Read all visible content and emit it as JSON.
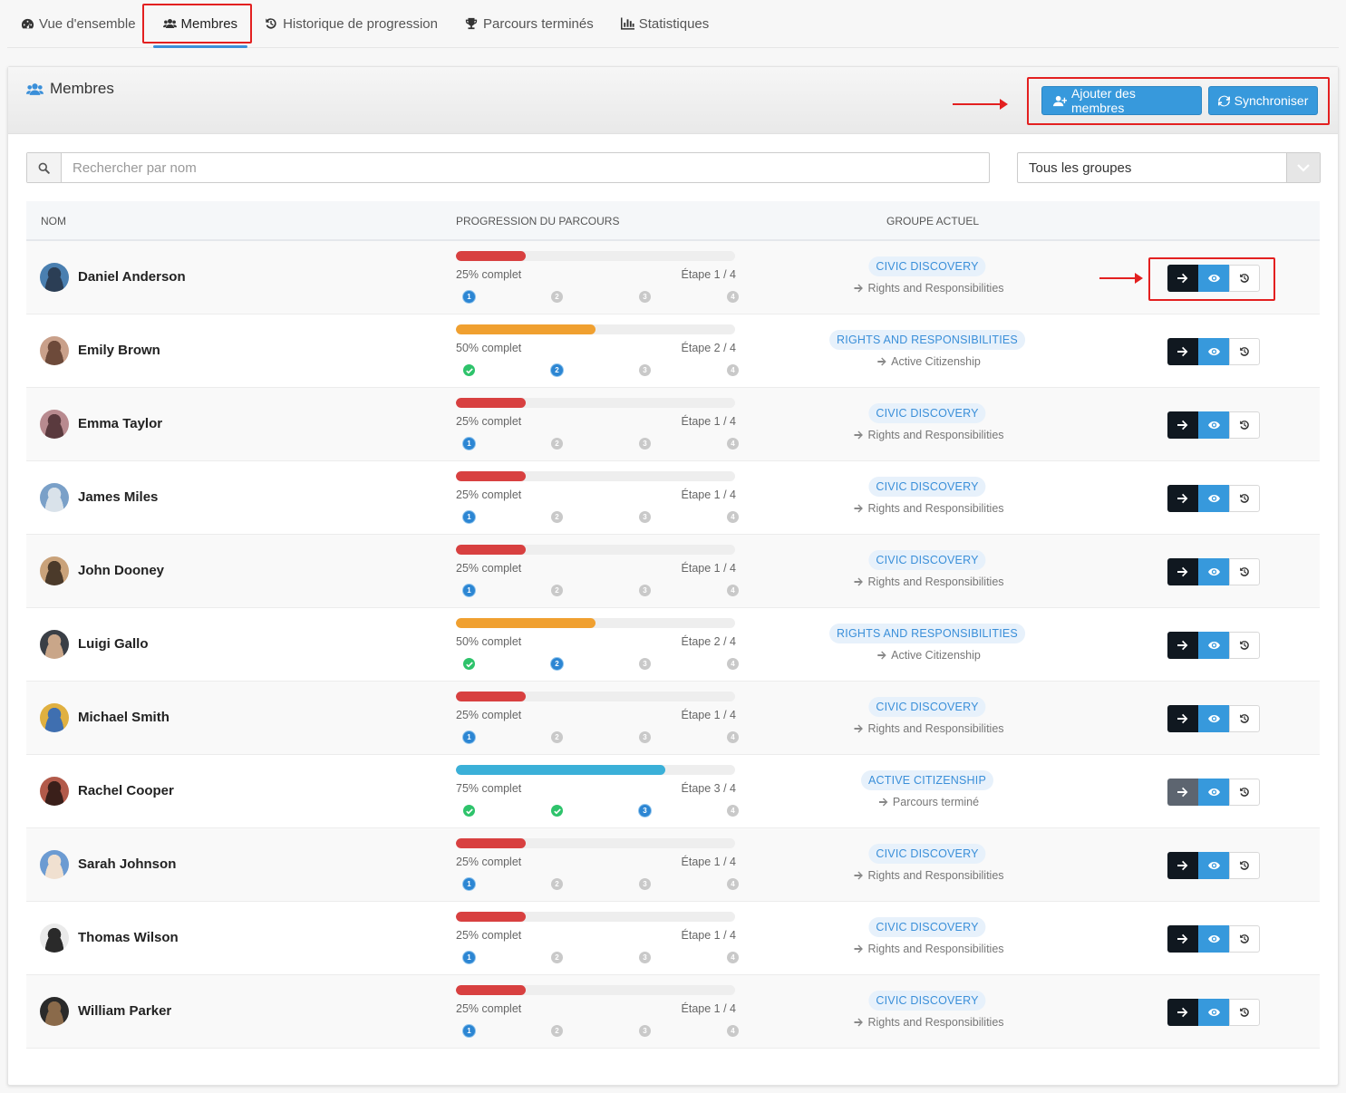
{
  "tabs": [
    {
      "label": "Vue d'ensemble",
      "icon": "dashboard-icon"
    },
    {
      "label": "Membres",
      "icon": "users-icon",
      "active": true
    },
    {
      "label": "Historique de progression",
      "icon": "history-icon"
    },
    {
      "label": "Parcours terminés",
      "icon": "trophy-icon"
    },
    {
      "label": "Statistiques",
      "icon": "bar-chart-icon"
    }
  ],
  "panel": {
    "title": "Membres",
    "add_button": "Ajouter des membres",
    "sync_button": "Synchroniser"
  },
  "search": {
    "placeholder": "Rechercher par nom"
  },
  "group_filter": {
    "selected": "Tous les groupes"
  },
  "table": {
    "headers": {
      "name": "NOM",
      "progress": "PROGRESSION DU PARCOURS",
      "group": "GROUPE ACTUEL"
    },
    "rows": [
      {
        "name": "Daniel Anderson",
        "progress": 25,
        "pct": "25% complet",
        "step": "Étape 1 / 4",
        "current_step": 1,
        "group": "CIVIC DISCOVERY",
        "next": "Rights and Responsibilities"
      },
      {
        "name": "Emily Brown",
        "progress": 50,
        "pct": "50% complet",
        "step": "Étape 2 / 4",
        "current_step": 2,
        "group": "RIGHTS AND RESPONSIBILITIES",
        "next": "Active Citizenship"
      },
      {
        "name": "Emma Taylor",
        "progress": 25,
        "pct": "25% complet",
        "step": "Étape 1 / 4",
        "current_step": 1,
        "group": "CIVIC DISCOVERY",
        "next": "Rights and Responsibilities"
      },
      {
        "name": "James Miles",
        "progress": 25,
        "pct": "25% complet",
        "step": "Étape 1 / 4",
        "current_step": 1,
        "group": "CIVIC DISCOVERY",
        "next": "Rights and Responsibilities"
      },
      {
        "name": "John Dooney",
        "progress": 25,
        "pct": "25% complet",
        "step": "Étape 1 / 4",
        "current_step": 1,
        "group": "CIVIC DISCOVERY",
        "next": "Rights and Responsibilities"
      },
      {
        "name": "Luigi Gallo",
        "progress": 50,
        "pct": "50% complet",
        "step": "Étape 2 / 4",
        "current_step": 2,
        "group": "RIGHTS AND RESPONSIBILITIES",
        "next": "Active Citizenship"
      },
      {
        "name": "Michael Smith",
        "progress": 25,
        "pct": "25% complet",
        "step": "Étape 1 / 4",
        "current_step": 1,
        "group": "CIVIC DISCOVERY",
        "next": "Rights and Responsibilities"
      },
      {
        "name": "Rachel Cooper",
        "progress": 75,
        "pct": "75% complet",
        "step": "Étape 3 / 4",
        "current_step": 3,
        "group": "ACTIVE CITIZENSHIP",
        "next": "Parcours terminé"
      },
      {
        "name": "Sarah Johnson",
        "progress": 25,
        "pct": "25% complet",
        "step": "Étape 1 / 4",
        "current_step": 1,
        "group": "CIVIC DISCOVERY",
        "next": "Rights and Responsibilities"
      },
      {
        "name": "Thomas Wilson",
        "progress": 25,
        "pct": "25% complet",
        "step": "Étape 1 / 4",
        "current_step": 1,
        "group": "CIVIC DISCOVERY",
        "next": "Rights and Responsibilities"
      },
      {
        "name": "William Parker",
        "progress": 25,
        "pct": "25% complet",
        "step": "Étape 1 / 4",
        "current_step": 1,
        "group": "CIVIC DISCOVERY",
        "next": "Rights and Responsibilities"
      }
    ]
  },
  "colors": {
    "accent": "#3799dc",
    "progress_25": "#d84040",
    "progress_50": "#f0a030",
    "progress_75": "#3bb0d8",
    "step_done": "#2ec36b",
    "annotation": "#e32020"
  }
}
